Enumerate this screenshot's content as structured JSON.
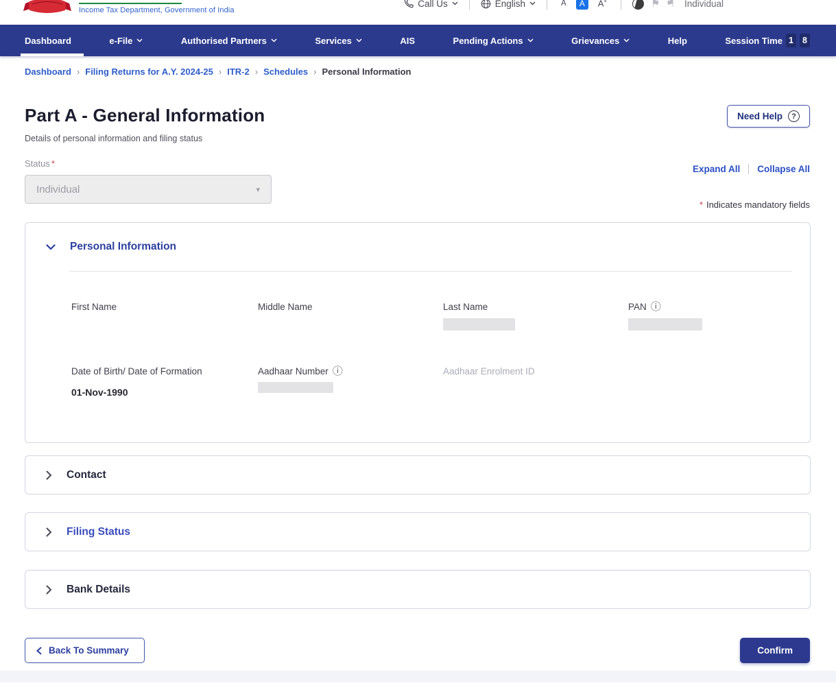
{
  "theme": {
    "nav_bg": "#2c3a8d",
    "link_blue": "#2f5ec9",
    "accent_blue": "#2b4fc5",
    "section_blue": "#2c3f9e",
    "confirm_bg": "#2c398e",
    "mandatory_red": "#d0424a",
    "masked_gray": "#e3e3e6"
  },
  "icons": {
    "info": "ⓘ",
    "flag": "⚑",
    "select_caret": "▾"
  },
  "header": {
    "logo_dept": "Income Tax Department, Government of India",
    "call_us": "Call Us",
    "language": "English",
    "font_decrease": "A",
    "font_default": "A",
    "font_increase": "A",
    "font_increase_mark": "+",
    "user_type": "Individual"
  },
  "nav": {
    "items": [
      {
        "label": "Dashboard"
      },
      {
        "label": "e-File"
      },
      {
        "label": "Authorised Partners"
      },
      {
        "label": "Services"
      },
      {
        "label": "AIS"
      },
      {
        "label": "Pending Actions"
      },
      {
        "label": "Grievances"
      },
      {
        "label": "Help"
      }
    ],
    "session_time_label": "Session Time",
    "session_digits": [
      "1",
      "8"
    ]
  },
  "breadcrumb": {
    "separator": "›",
    "items": [
      {
        "label": "Dashboard"
      },
      {
        "label": "Filing Returns for A.Y. 2024-25"
      },
      {
        "label": "ITR-2"
      },
      {
        "label": "Schedules"
      },
      {
        "label": "Personal Information"
      }
    ]
  },
  "page": {
    "title": "Part A - General Information",
    "subtitle": "Details of personal information and filing status",
    "need_help_label": "Need Help",
    "qmark_glyph": "?",
    "status_label": "Status",
    "status_required": "*",
    "status_value": "Individual",
    "expand_all": "Expand All",
    "collapse_all": "Collapse All",
    "mandatory_star": "*",
    "mandatory_note": "Indicates mandatory fields"
  },
  "sections": {
    "personal_information": {
      "title": "Personal Information",
      "first_name_label": "First Name",
      "middle_name_label": "Middle Name",
      "last_name_label": "Last Name",
      "pan_label": "PAN",
      "dob_label": "Date of Birth/ Date of Formation",
      "dob_value": "01-Nov-1990",
      "aadhaar_label": "Aadhaar Number",
      "aadhaar_enrolment_label": "Aadhaar Enrolment ID"
    },
    "contact": {
      "title": "Contact"
    },
    "filing_status": {
      "title": "Filing Status"
    },
    "bank_details": {
      "title": "Bank Details"
    }
  },
  "footer_actions": {
    "back_label": "Back To Summary",
    "confirm_label": "Confirm"
  }
}
